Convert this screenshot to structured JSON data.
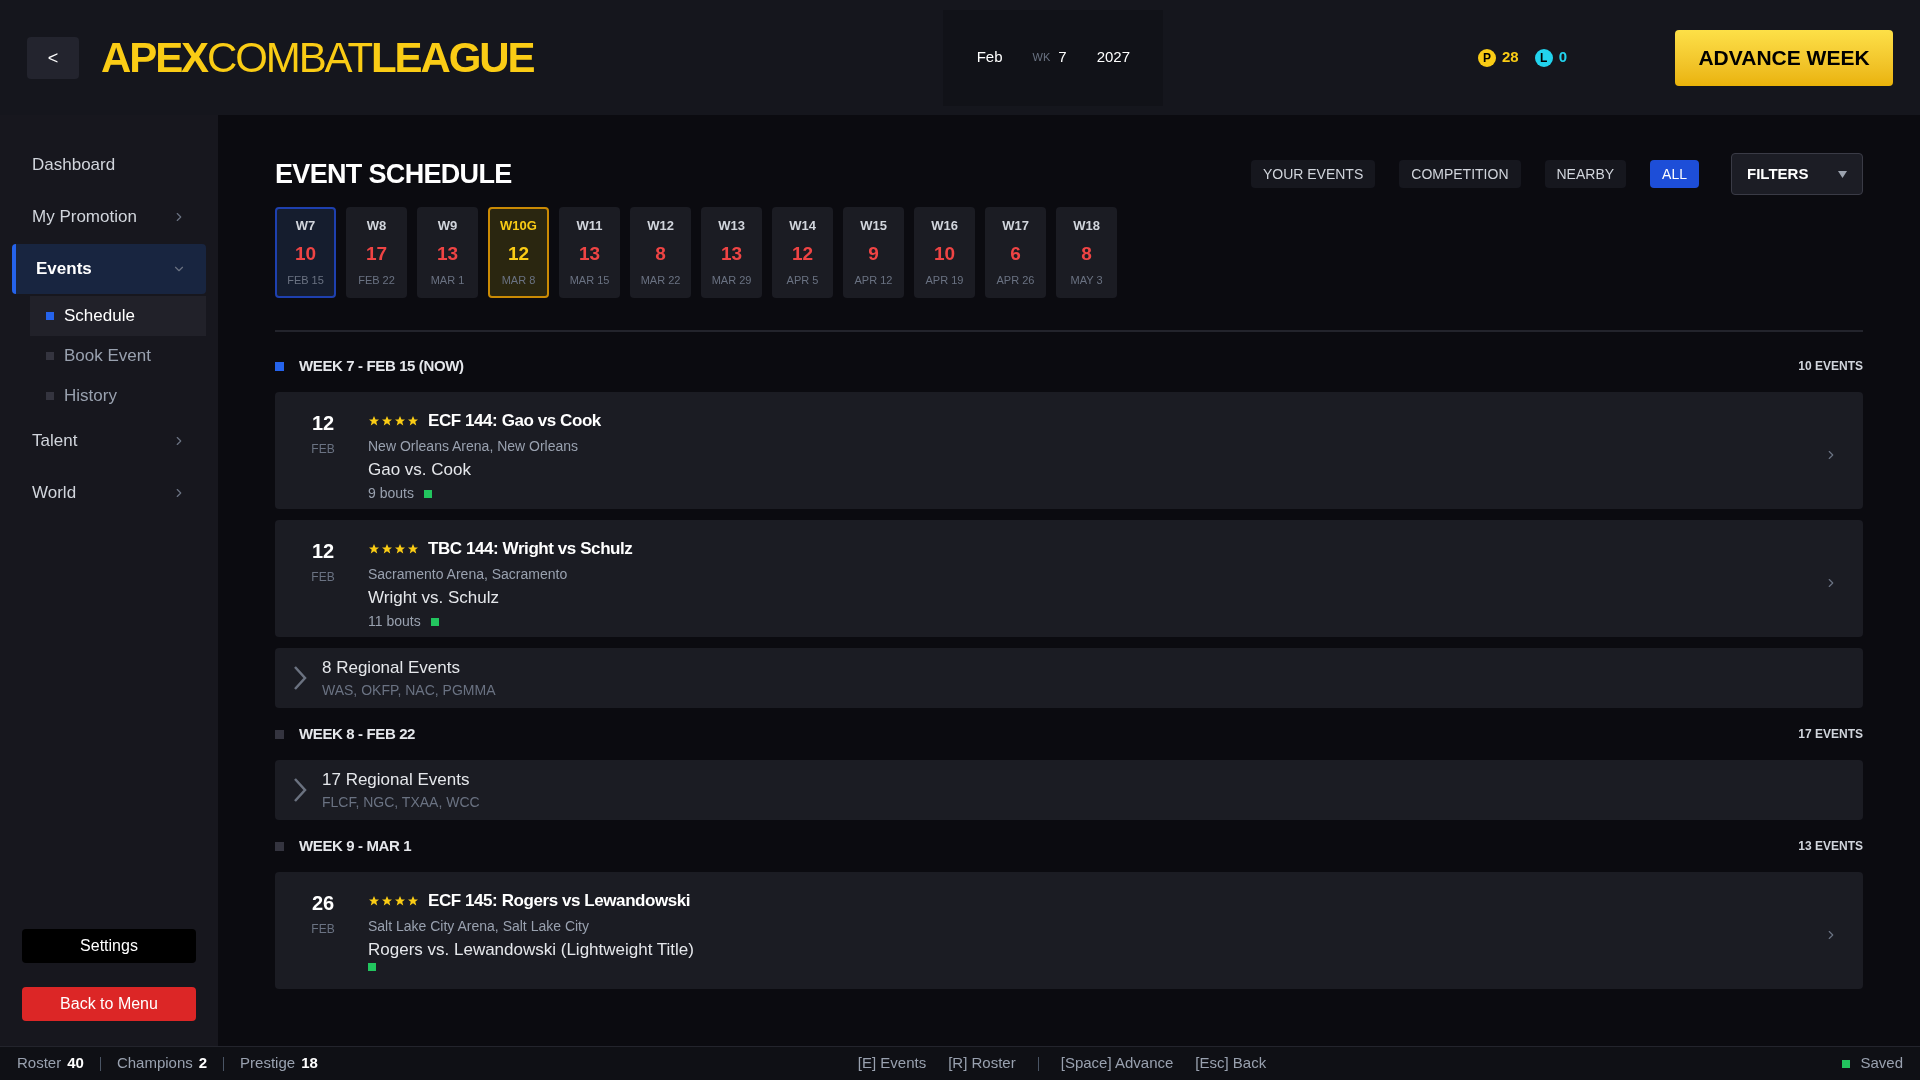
{
  "header": {
    "back": "<",
    "logo": [
      {
        "text": "APEX",
        "bold": true
      },
      {
        "text": "COMBAT",
        "bold": false
      },
      {
        "text": "LEAGUE",
        "bold": true
      }
    ],
    "date": {
      "month": "Feb",
      "week_label": "WK",
      "week": "7",
      "year": "2027"
    },
    "currencies": [
      {
        "symbol": "P",
        "value": "28",
        "color": "#facc15"
      },
      {
        "symbol": "L",
        "value": "0",
        "color": "#22d3ee"
      }
    ],
    "advance": "ADVANCE WEEK"
  },
  "sidebar": {
    "items": [
      {
        "label": "Dashboard",
        "selected": false
      },
      {
        "label": "My Promotion",
        "selected": false,
        "arrow": true,
        "expanded": false
      },
      {
        "label": "Events",
        "selected": true,
        "arrow": true,
        "expanded": true,
        "children": [
          {
            "label": "Schedule",
            "selected": true
          },
          {
            "label": "Book Event",
            "selected": false
          },
          {
            "label": "History",
            "selected": false
          }
        ]
      },
      {
        "label": "Talent",
        "selected": false,
        "arrow": true,
        "expanded": false
      },
      {
        "label": "World",
        "selected": false,
        "arrow": true,
        "expanded": false
      }
    ],
    "settings": "Settings",
    "back_to_menu": "Back to Menu"
  },
  "main": {
    "title": "EVENT SCHEDULE",
    "filters": [
      {
        "label": "YOUR EVENTS",
        "selected": false
      },
      {
        "label": "COMPETITION",
        "selected": false
      },
      {
        "label": "NEARBY",
        "selected": false
      },
      {
        "label": "ALL",
        "selected": true
      }
    ],
    "filters_dropdown": "FILTERS",
    "weeks": [
      {
        "week": "W7",
        "count": "10",
        "date": "FEB 15",
        "selected": true,
        "marked": false
      },
      {
        "week": "W8",
        "count": "17",
        "date": "FEB 22",
        "selected": false,
        "marked": false
      },
      {
        "week": "W9",
        "count": "13",
        "date": "MAR 1",
        "selected": false,
        "marked": false
      },
      {
        "week": "W10G",
        "count": "12",
        "date": "MAR 8",
        "selected": false,
        "marked": true
      },
      {
        "week": "W11",
        "count": "13",
        "date": "MAR 15",
        "selected": false,
        "marked": false
      },
      {
        "week": "W12",
        "count": "8",
        "date": "MAR 22",
        "selected": false,
        "marked": false
      },
      {
        "week": "W13",
        "count": "13",
        "date": "MAR 29",
        "selected": false,
        "marked": false
      },
      {
        "week": "W14",
        "count": "12",
        "date": "APR 5",
        "selected": false,
        "marked": false
      },
      {
        "week": "W15",
        "count": "9",
        "date": "APR 12",
        "selected": false,
        "marked": false
      },
      {
        "week": "W16",
        "count": "10",
        "date": "APR 19",
        "selected": false,
        "marked": false
      },
      {
        "week": "W17",
        "count": "6",
        "date": "APR 26",
        "selected": false,
        "marked": false
      },
      {
        "week": "W18",
        "count": "8",
        "date": "MAY 3",
        "selected": false,
        "marked": false
      }
    ],
    "groups": [
      {
        "heading": "WEEK 7 - FEB 15 (NOW)",
        "current": true,
        "count": "10 EVENTS",
        "items": [
          {
            "kind": "event",
            "day": "12",
            "month": "FEB",
            "stars": 4,
            "title": "ECF 144: Gao vs Cook",
            "venue": "New Orleans Arena, New Orleans",
            "main_event": "Gao vs. Cook",
            "bouts": "9 bouts",
            "color": "#22c55e"
          },
          {
            "kind": "event",
            "day": "12",
            "month": "FEB",
            "stars": 4,
            "title": "TBC 144: Wright vs Schulz",
            "venue": "Sacramento Arena, Sacramento",
            "main_event": "Wright vs. Schulz",
            "bouts": "11 bouts",
            "color": "#22c55e"
          },
          {
            "kind": "regional",
            "title": "8 Regional Events",
            "orgs": "WAS, OKFP, NAC, PGMMA"
          }
        ]
      },
      {
        "heading": "WEEK 8 - FEB 22",
        "current": false,
        "count": "17 EVENTS",
        "items": [
          {
            "kind": "regional",
            "title": "17 Regional Events",
            "orgs": "FLCF, NGC, TXAA, WCC"
          }
        ]
      },
      {
        "heading": "WEEK 9 - MAR 1",
        "current": false,
        "count": "13 EVENTS",
        "items": [
          {
            "kind": "event",
            "day": "26",
            "month": "FEB",
            "stars": 4,
            "title": "ECF 145: Rogers vs Lewandowski",
            "venue": "Salt Lake City Arena, Salt Lake City",
            "main_event": "Rogers vs. Lewandowski (Lightweight Title)",
            "color": "#22c55e"
          }
        ]
      }
    ]
  },
  "status_bar": {
    "stats": [
      {
        "label": "Roster",
        "value": "40"
      },
      {
        "label": "Champions",
        "value": "2"
      },
      {
        "label": "Prestige",
        "value": "18"
      }
    ],
    "shortcuts": [
      {
        "key": "[E]",
        "label": "Events"
      },
      {
        "key": "[R]",
        "label": "Roster"
      },
      {
        "key": "[Space]",
        "label": "Advance"
      },
      {
        "key": "[Esc]",
        "label": "Back"
      }
    ],
    "save": {
      "label": "Saved",
      "color": "#22c55e"
    }
  }
}
